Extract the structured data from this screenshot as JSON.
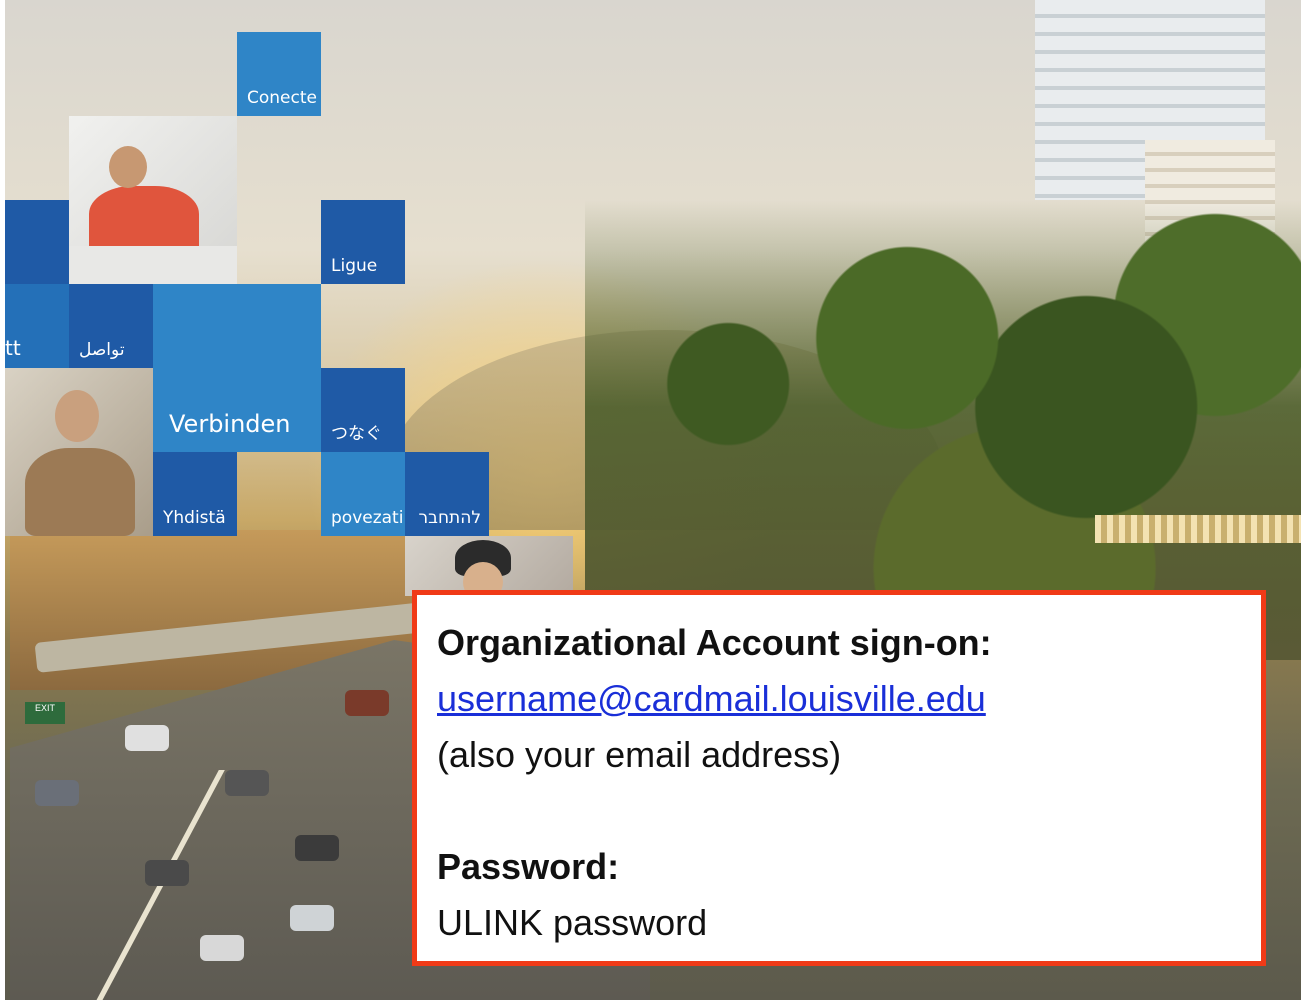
{
  "tiles": {
    "conecte": "Conecte",
    "ligue": "Ligue",
    "tt": "tt",
    "arabic": "تواصل",
    "verbinden": "Verbinden",
    "japanese": "つなぐ",
    "yhdista": "Yhdistä",
    "povezati": "povezati",
    "hebrew": "להתחבר"
  },
  "road_sign": "EXIT",
  "info_box": {
    "account_heading": "Organizational Account sign-on:",
    "account_email": "username@cardmail.louisville.edu",
    "account_note": "(also your email address)",
    "password_heading": "Password:",
    "password_value": "ULINK password",
    "border_color": "#f03a17",
    "link_color": "#1a2fd8"
  }
}
